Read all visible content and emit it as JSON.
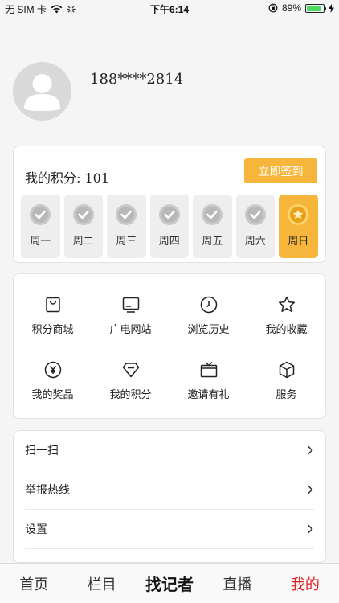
{
  "status_bar": {
    "carrier": "无 SIM 卡",
    "time": "下午6:14",
    "battery_percent_label": "89%",
    "battery_level": 0.89,
    "battery_color": "#4cd964"
  },
  "profile": {
    "phone": "188****2814",
    "avatar_icon": "user-avatar-icon"
  },
  "points": {
    "label": "我的积分: 101",
    "signin_label": "立即签到",
    "accent_color": "#f6b63c",
    "days": [
      {
        "label": "周一",
        "icon": "check-circle-icon",
        "state": "checked"
      },
      {
        "label": "周二",
        "icon": "check-circle-icon",
        "state": "checked"
      },
      {
        "label": "周三",
        "icon": "check-circle-icon",
        "state": "checked"
      },
      {
        "label": "周四",
        "icon": "check-circle-icon",
        "state": "checked"
      },
      {
        "label": "周五",
        "icon": "check-circle-icon",
        "state": "checked"
      },
      {
        "label": "周六",
        "icon": "check-circle-icon",
        "state": "checked"
      },
      {
        "label": "周日",
        "icon": "star-coin-icon",
        "state": "today"
      }
    ]
  },
  "features": [
    {
      "label": "积分商城",
      "icon": "shopping-bag-icon"
    },
    {
      "label": "广电网站",
      "icon": "tv-monitor-icon"
    },
    {
      "label": "浏览历史",
      "icon": "clock-icon"
    },
    {
      "label": "我的收藏",
      "icon": "star-icon"
    },
    {
      "label": "我的奖品",
      "icon": "yen-coin-icon"
    },
    {
      "label": "我的积分",
      "icon": "diamond-icon"
    },
    {
      "label": "邀请有礼",
      "icon": "gift-tv-icon"
    },
    {
      "label": "服务",
      "icon": "cube-icon"
    }
  ],
  "menu": [
    {
      "label": "扫一扫",
      "icon": "chevron-right-icon"
    },
    {
      "label": "举报热线",
      "icon": "chevron-right-icon"
    },
    {
      "label": "设置",
      "icon": "chevron-right-icon"
    }
  ],
  "tabs": {
    "home": "首页",
    "columns": "栏目",
    "logo_text": "找记者",
    "live": "直播",
    "mine": "我的",
    "active_color": "#e02020"
  }
}
